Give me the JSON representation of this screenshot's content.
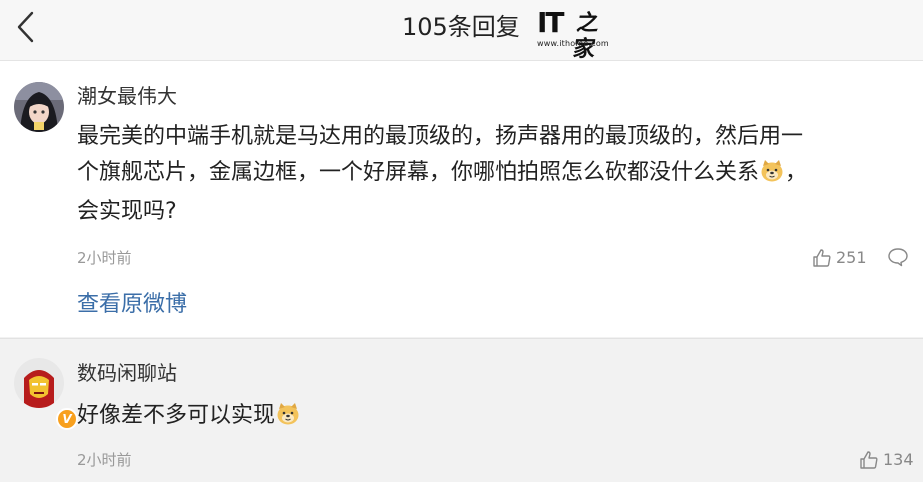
{
  "header": {
    "title": "105条回复",
    "logo_text": "IT",
    "logo_zh": "之家",
    "logo_url": "www.ithome.com"
  },
  "comments": [
    {
      "username": "潮女最伟大",
      "content_lines": [
        "最完美的中端手机就是马达用的最顶级的，扬声器用的最顶级的，然后用一",
        "个旗舰芯片，金属边框，一个好屏幕，你哪怕拍照怎么砍都没什么关系",
        "会实现吗?"
      ],
      "content_line2_tail": "，",
      "time": "2小时前",
      "likes": "251",
      "view_original": "查看原微博"
    },
    {
      "username": "数码闲聊站",
      "content": "好像差不多可以实现",
      "time": "2小时前",
      "likes": "134",
      "badge": "V"
    }
  ],
  "icons": [
    "back-chevron-icon",
    "like-icon",
    "comment-icon",
    "doge-emoji-icon",
    "verified-badge-icon"
  ],
  "colors": {
    "link": "#3b6ea8",
    "background": "#f2f2f2",
    "card": "#ffffff",
    "badge": "#f8a01e"
  }
}
